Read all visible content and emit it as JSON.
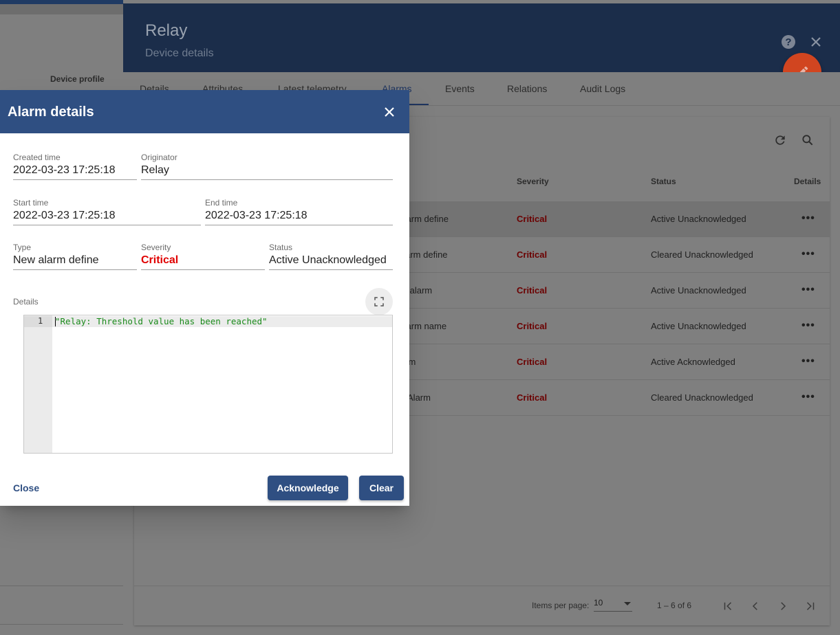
{
  "background_list": {
    "column_label": "Device profile"
  },
  "drawer": {
    "title": "Relay",
    "subtitle": "Device details",
    "tabs": [
      {
        "label": "Details"
      },
      {
        "label": "Attributes"
      },
      {
        "label": "Latest telemetry"
      },
      {
        "label": "Alarms",
        "active": true
      },
      {
        "label": "Events"
      },
      {
        "label": "Relations"
      },
      {
        "label": "Audit Logs"
      }
    ],
    "table": {
      "headers": {
        "severity": "Severity",
        "status": "Status",
        "details": "Details"
      },
      "rows": [
        {
          "type_partial": "Alarm define",
          "severity": "Critical",
          "status": "Active Unacknowledged"
        },
        {
          "type_partial": "alarm define",
          "severity": "Critical",
          "status": "Cleared Unacknowledged"
        },
        {
          "type_partial": "ck alarm",
          "severity": "Critical",
          "status": "Active Unacknowledged"
        },
        {
          "type_partial": "Alarm name",
          "severity": "Critical",
          "status": "Active Unacknowledged"
        },
        {
          "type_partial": "larm",
          "severity": "Critical",
          "status": "Active Acknowledged"
        },
        {
          "type_partial": "al Alarm",
          "severity": "Critical",
          "status": "Cleared Unacknowledged"
        }
      ],
      "more_glyph": "•••"
    },
    "paginator": {
      "items_per_page_label": "Items per page:",
      "items_per_page_value": "10",
      "range_label": "1 – 6 of 6"
    }
  },
  "dialog": {
    "title": "Alarm details",
    "created_time": {
      "label": "Created time",
      "value": "2022-03-23 17:25:18"
    },
    "originator": {
      "label": "Originator",
      "value": "Relay"
    },
    "start_time": {
      "label": "Start time",
      "value": "2022-03-23 17:25:18"
    },
    "end_time": {
      "label": "End time",
      "value": "2022-03-23 17:25:18"
    },
    "type": {
      "label": "Type",
      "value": "New alarm define"
    },
    "severity": {
      "label": "Severity",
      "value": "Critical"
    },
    "status": {
      "label": "Status",
      "value": "Active Unacknowledged"
    },
    "details": {
      "label": "Details",
      "line_number": "1",
      "code": "\"Relay: Threshold value has been reached\""
    },
    "actions": {
      "close": "Close",
      "acknowledge": "Acknowledge",
      "clear": "Clear"
    }
  },
  "colors": {
    "primary": "#2f4f82",
    "critical": "#e00000",
    "fab": "#d14520"
  }
}
